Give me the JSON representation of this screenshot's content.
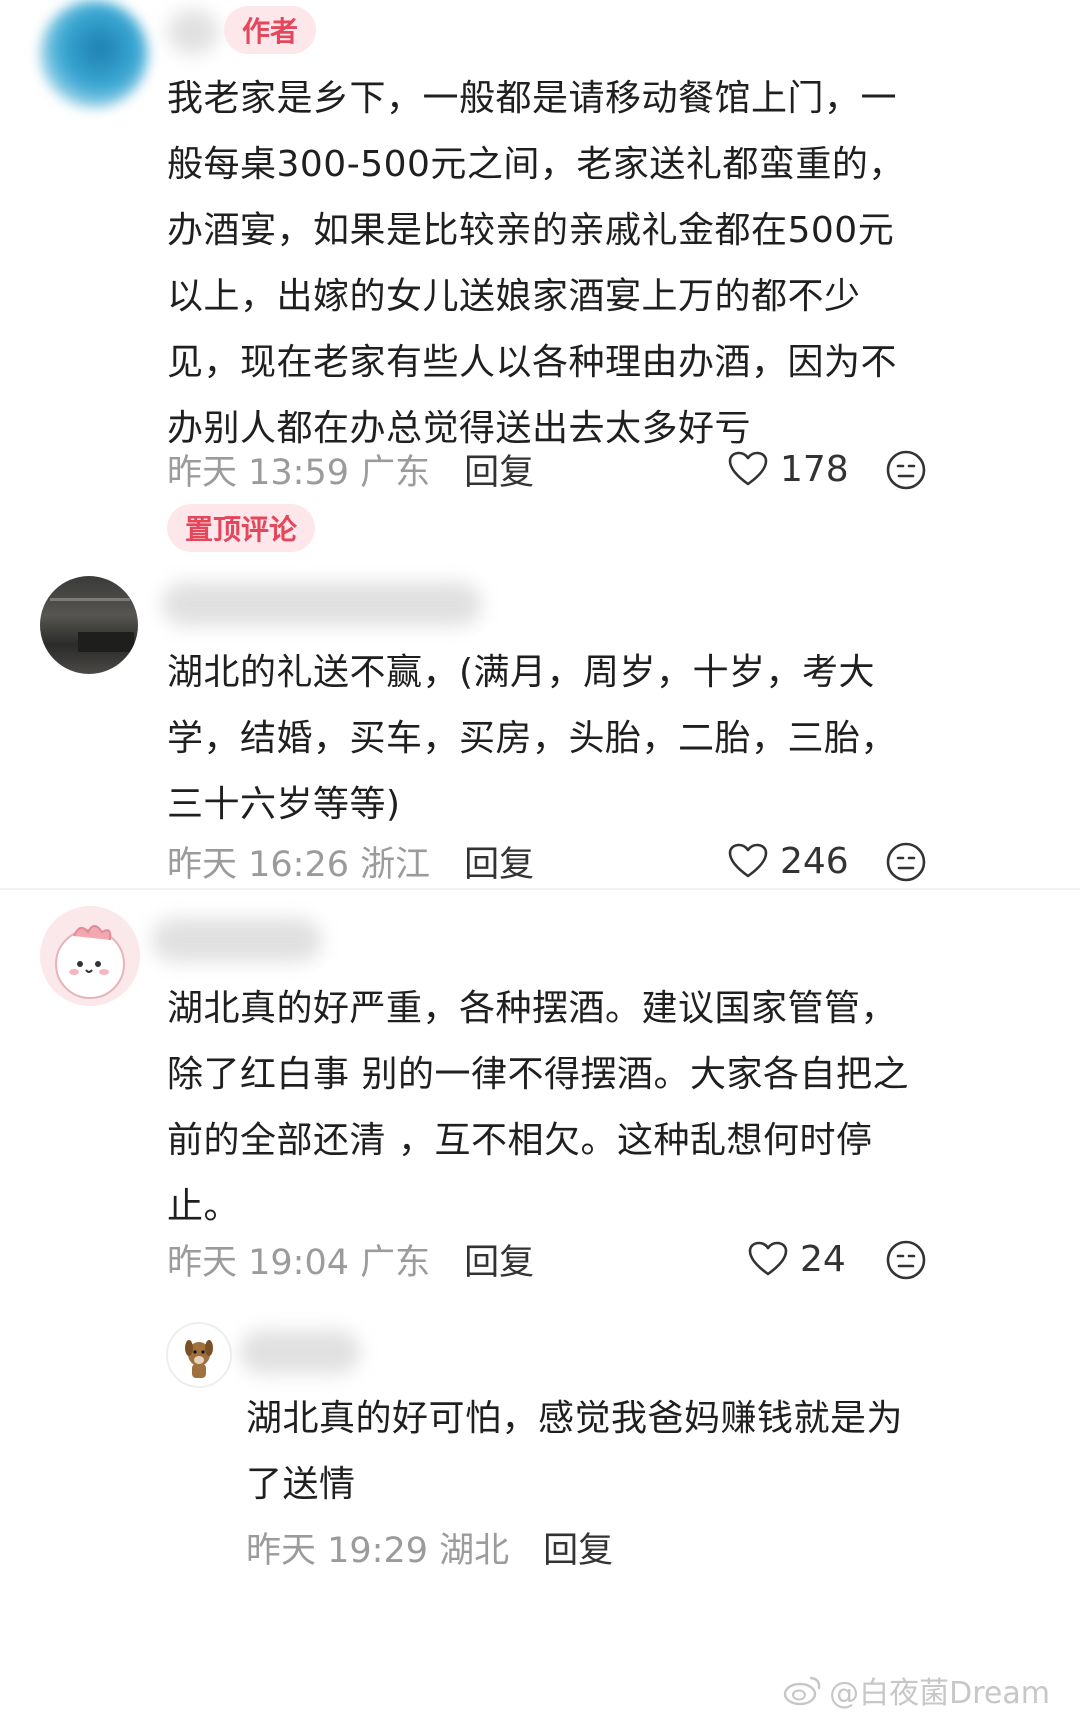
{
  "comments": [
    {
      "badge": "作者",
      "lines": [
        "我老家是乡下，一般都是请移动餐馆上门，一",
        "般每桌300-500元之间，老家送礼都蛮重的，",
        "办酒宴，如果是比较亲的亲戚礼金都在500元",
        "以上，出嫁的女儿送娘家酒宴上万的都不少",
        "见，现在老家有些人以各种理由办酒，因为不",
        "办别人都在办总觉得送出去太多好亏"
      ],
      "time": "昨天 13:59 广东",
      "reply": "回复",
      "likes": "178",
      "pinned_label": "置顶评论"
    },
    {
      "lines": [
        "湖北的礼送不赢，(满月，周岁，十岁，考大",
        "学，结婚，买车，买房，头胎，二胎，三胎，",
        "三十六岁等等)"
      ],
      "time": "昨天 16:26 浙江",
      "reply": "回复",
      "likes": "246"
    },
    {
      "lines": [
        "湖北真的好严重，各种摆酒。建议国家管管，",
        "除了红白事 别的一律不得摆酒。大家各自把之",
        "前的全部还清 ，互不相欠。这种乱想何时停",
        "止。"
      ],
      "time": "昨天 19:04 广东",
      "reply": "回复",
      "likes": "24"
    },
    {
      "lines": [
        "湖北真的好可怕，感觉我爸妈赚钱就是为",
        "了送情"
      ],
      "time": "昨天 19:29 湖北",
      "reply": "回复"
    }
  ],
  "watermark": "@白夜菌Dream",
  "icons": {
    "like": "heart-outline-icon",
    "emoji": "emoji-face-icon",
    "weibo": "weibo-logo-icon"
  },
  "colors": {
    "badge_bg": "#fde7ea",
    "badge_text": "#e4475b",
    "meta_text": "#9b9b9b"
  }
}
